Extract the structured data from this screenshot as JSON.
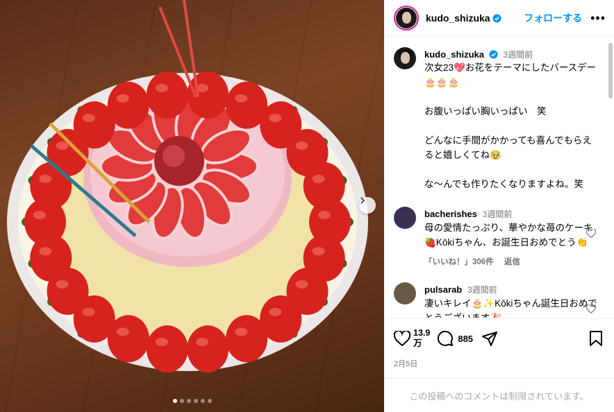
{
  "post": {
    "username": "kudo_shizuka",
    "follow_label": "フォローする",
    "more_label": "•••"
  },
  "caption": {
    "username": "kudo_shizuka",
    "time": "3週間前",
    "text": "次女23💖お花をテーマにしたバースデー🎂🎂🎂\n\nお腹いっぱい胸いっぱい　笑\n\nどんなに手間がかかっても喜んでもらえると嬉しくてね🥹\n\nな〜んでも作りたくなりますよね。笑"
  },
  "comments": [
    {
      "username": "bacherishes",
      "time": "3週間前",
      "text": "母の愛情たっぷり、華やかな苺のケーキ🍓Kōkiちゃん、お誕生日おめでとう👏",
      "likes_label": "「いいね！」306件",
      "reply_label": "返信"
    },
    {
      "username": "pulsarab",
      "time": "3週間前",
      "text": "凄いキレイ🎂✨Kōkiちゃん誕生日おめでとうございます🎉"
    }
  ],
  "actions": {
    "likes": "13.9\n万",
    "comment_count": "885",
    "date": "2月5日"
  },
  "comment_limited_text": "この投稿へのコメントは制限されています。",
  "carousel": {
    "total": 6,
    "active": 1
  },
  "colors": {
    "accent": "#0095f6",
    "verified": "#0095f6",
    "story_ring": "#d6249f"
  }
}
